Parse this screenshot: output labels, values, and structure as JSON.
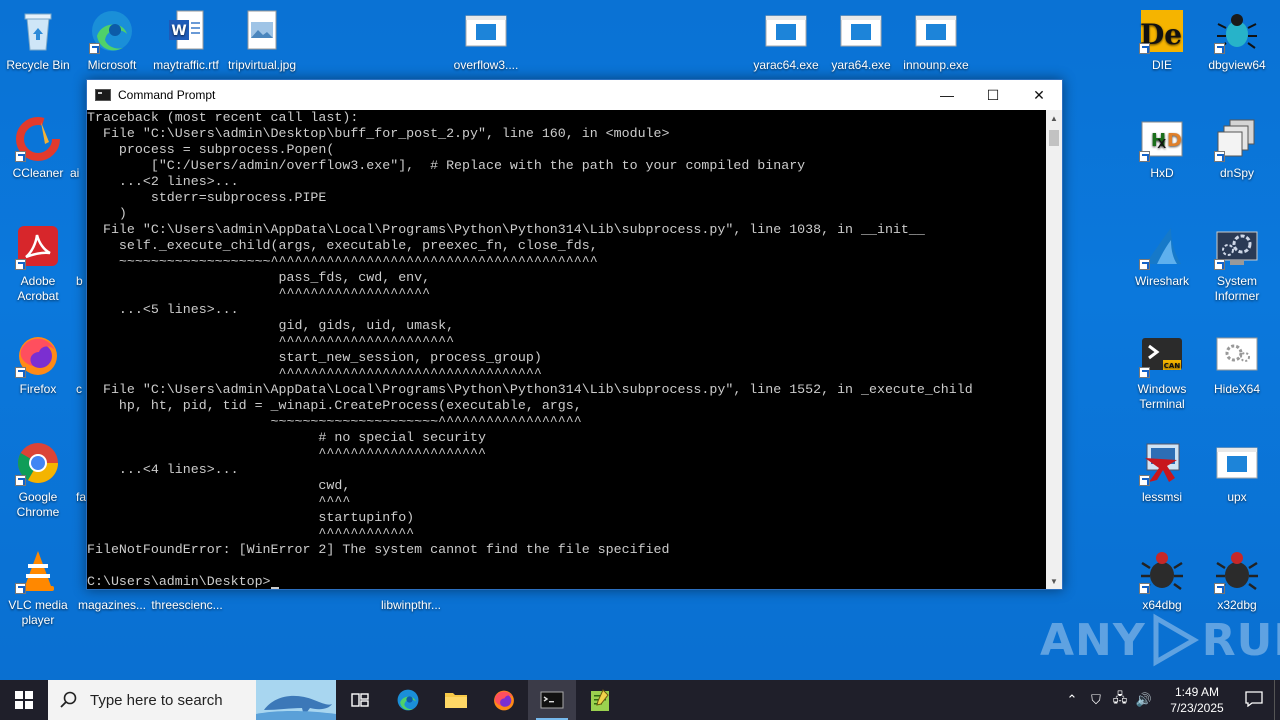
{
  "desktop": {
    "icons_left": [
      {
        "label": "Recycle Bin"
      },
      {
        "label": "Microsoft Edge"
      },
      {
        "label": "maytraffic.rtf"
      },
      {
        "label": "tripvirtual.jpg"
      },
      {
        "label": "overflow3...."
      },
      {
        "label": "yarac64.exe"
      },
      {
        "label": "yara64.exe"
      },
      {
        "label": "innounp.exe"
      },
      {
        "label": "CCleaner"
      },
      {
        "label": "ai"
      },
      {
        "label": "Adobe Acrobat"
      },
      {
        "label": "b"
      },
      {
        "label": "Firefox"
      },
      {
        "label": "c"
      },
      {
        "label": "Google Chrome"
      },
      {
        "label": "fa"
      },
      {
        "label": "VLC media player"
      },
      {
        "label": "magazines..."
      },
      {
        "label": "threescienc..."
      },
      {
        "label": "libwinpthr..."
      }
    ],
    "icons_right": [
      {
        "label": "DIE"
      },
      {
        "label": "dbgview64"
      },
      {
        "label": "HxD"
      },
      {
        "label": "dnSpy"
      },
      {
        "label": "Wireshark"
      },
      {
        "label": "System Informer"
      },
      {
        "label": "Windows Terminal"
      },
      {
        "label": "HideX64"
      },
      {
        "label": "lessmsi"
      },
      {
        "label": "upx"
      },
      {
        "label": "x64dbg"
      },
      {
        "label": "x32dbg"
      }
    ]
  },
  "window": {
    "title": "Command Prompt",
    "minimize": "—",
    "maximize": "☐",
    "close": "✕",
    "lines": [
      "Traceback (most recent call last):",
      "  File \"C:\\Users\\admin\\Desktop\\buff_for_post_2.py\", line 160, in <module>",
      "    process = subprocess.Popen(",
      "        [\"C:/Users/admin/overflow3.exe\"],  # Replace with the path to your compiled binary",
      "    ...<2 lines>...",
      "        stderr=subprocess.PIPE",
      "    )",
      "  File \"C:\\Users\\admin\\AppData\\Local\\Programs\\Python\\Python314\\Lib\\subprocess.py\", line 1038, in __init__",
      "    self._execute_child(args, executable, preexec_fn, close_fds,",
      "    ~~~~~~~~~~~~~~~~~~~^^^^^^^^^^^^^^^^^^^^^^^^^^^^^^^^^^^^^^^^^",
      "                        pass_fds, cwd, env,",
      "                        ^^^^^^^^^^^^^^^^^^^",
      "    ...<5 lines>...",
      "                        gid, gids, uid, umask,",
      "                        ^^^^^^^^^^^^^^^^^^^^^^",
      "                        start_new_session, process_group)",
      "                        ^^^^^^^^^^^^^^^^^^^^^^^^^^^^^^^^^",
      "  File \"C:\\Users\\admin\\AppData\\Local\\Programs\\Python\\Python314\\Lib\\subprocess.py\", line 1552, in _execute_child",
      "    hp, ht, pid, tid = _winapi.CreateProcess(executable, args,",
      "                       ~~~~~~~~~~~~~~~~~~~~~^^^^^^^^^^^^^^^^^^",
      "                             # no special security",
      "                             ^^^^^^^^^^^^^^^^^^^^^",
      "    ...<4 lines>...",
      "                             cwd,",
      "                             ^^^^",
      "                             startupinfo)",
      "                             ^^^^^^^^^^^^",
      "FileNotFoundError: [WinError 2] The system cannot find the file specified",
      "",
      "C:\\Users\\admin\\Desktop>"
    ]
  },
  "watermark": {
    "left": "ANY",
    "right": "RUN"
  },
  "taskbar": {
    "search_placeholder": "Type here to search",
    "time": "1:49 AM",
    "date": "7/23/2025"
  }
}
